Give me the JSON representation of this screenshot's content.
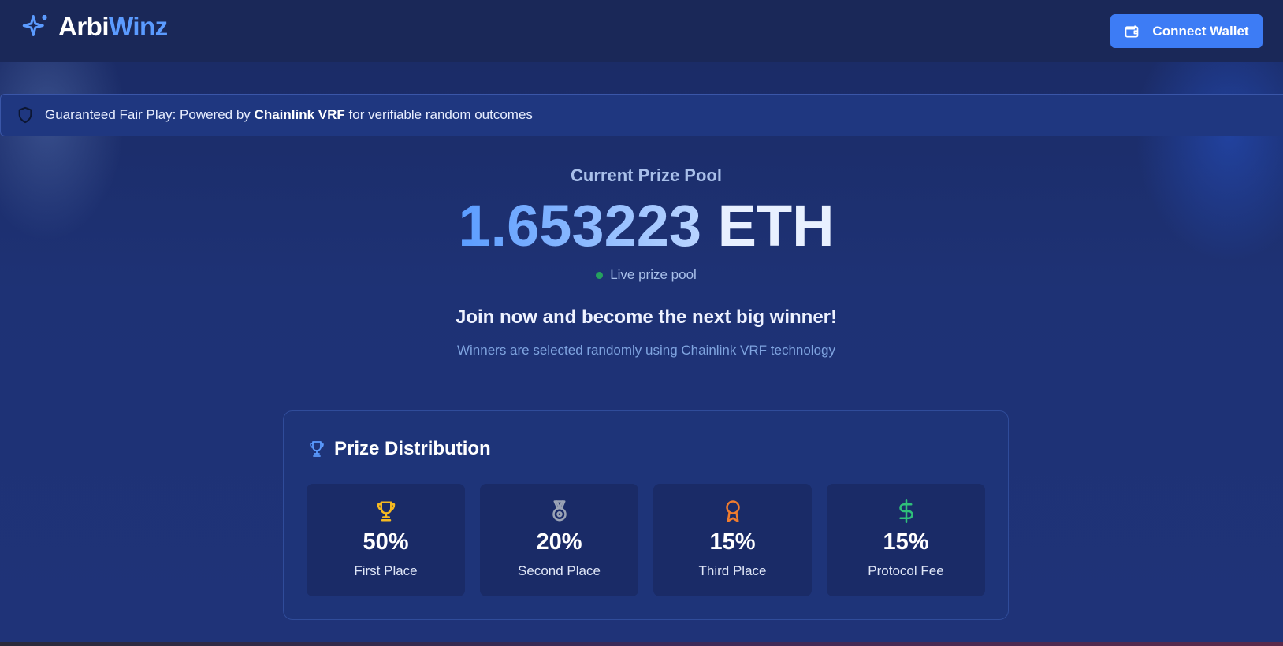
{
  "brand": {
    "name_part1": "Arbi",
    "name_part2": "Winz"
  },
  "header": {
    "connect_wallet_label": "Connect Wallet"
  },
  "banner": {
    "text_before": "Guaranteed Fair Play: Powered by",
    "text_bold": "Chainlink VRF",
    "text_after": "for verifiable random outcomes"
  },
  "hero": {
    "pool_label": "Current Prize Pool",
    "pool_value": "1.653223",
    "pool_unit": "ETH",
    "live_label": "Live prize pool",
    "headline": "Join now and become the next big winner!",
    "subline": "Winners are selected randomly using Chainlink VRF technology"
  },
  "distribution": {
    "title": "Prize Distribution",
    "tiles": [
      {
        "percent": "50%",
        "label": "First Place",
        "icon": "trophy-icon",
        "color": "#f5b921"
      },
      {
        "percent": "20%",
        "label": "Second Place",
        "icon": "medal-icon",
        "color": "#9aa3b5"
      },
      {
        "percent": "15%",
        "label": "Third Place",
        "icon": "award-icon",
        "color": "#f07c2e"
      },
      {
        "percent": "15%",
        "label": "Protocol Fee",
        "icon": "dollar-icon",
        "color": "#2fc07a"
      }
    ]
  },
  "colors": {
    "accent": "#3d7cf5",
    "brand_blue": "#5b9bff",
    "live": "#25a05e"
  }
}
